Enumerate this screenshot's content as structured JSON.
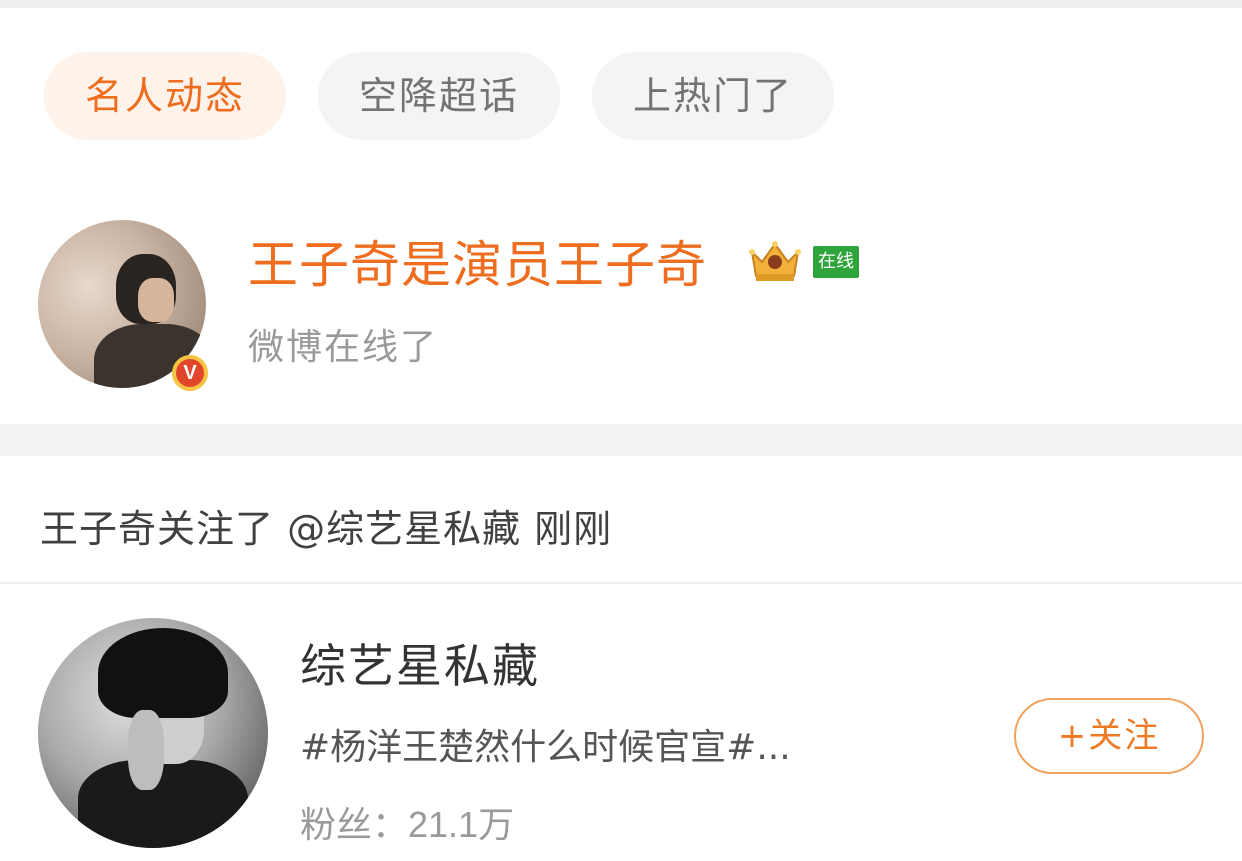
{
  "tabs": [
    {
      "label": "名人动态",
      "active": true
    },
    {
      "label": "空降超话",
      "active": false
    },
    {
      "label": "上热门了",
      "active": false
    }
  ],
  "celebrity": {
    "name": "王子奇是演员王子奇",
    "status_tag": "在线",
    "subtitle": "微博在线了",
    "verified_badge": "V",
    "icons": [
      "crown-badge-icon",
      "verified-v-icon"
    ]
  },
  "activity": {
    "text": "王子奇关注了 @综艺星私藏 刚刚"
  },
  "user_card": {
    "name": "综艺星私藏",
    "description": "#杨洋王楚然什么时候官宣#...",
    "fans_label": "粉丝：",
    "fans_count": "21.1万",
    "follow_button": "+关注"
  },
  "colors": {
    "accent": "#ee6d1f",
    "tab_active_bg": "#fdf3ea",
    "online_green": "#2fa43c",
    "verified_red": "#e2462a"
  }
}
